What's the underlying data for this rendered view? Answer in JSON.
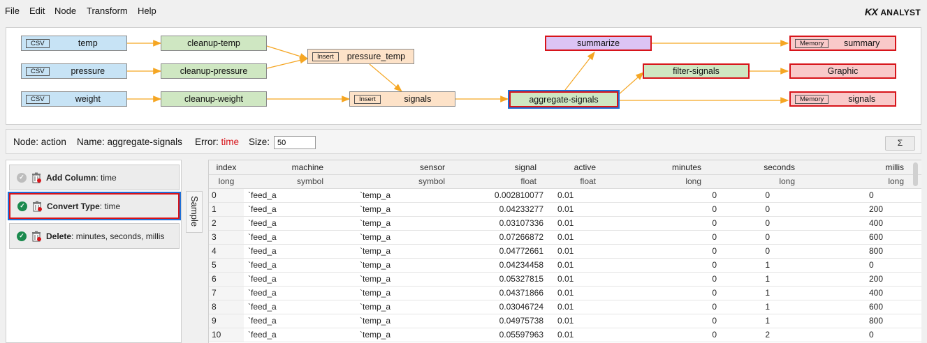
{
  "menu": {
    "items": [
      "File",
      "Edit",
      "Node",
      "Transform",
      "Help"
    ],
    "brand_logo": "KX",
    "brand_text": "ANALYST"
  },
  "workflow": {
    "nodes": {
      "csv_temp": {
        "tag": "CSV",
        "label": "temp"
      },
      "csv_pressure": {
        "tag": "CSV",
        "label": "pressure"
      },
      "csv_weight": {
        "tag": "CSV",
        "label": "weight"
      },
      "cleanup_temp": {
        "label": "cleanup-temp"
      },
      "cleanup_pressure": {
        "label": "cleanup-pressure"
      },
      "cleanup_weight": {
        "label": "cleanup-weight"
      },
      "pressure_temp": {
        "tag": "Insert",
        "label": "pressure_temp"
      },
      "signals_insert": {
        "tag": "Insert",
        "label": "signals"
      },
      "aggregate": {
        "label": "aggregate-signals"
      },
      "summarize": {
        "label": "summarize"
      },
      "filter": {
        "label": "filter-signals"
      },
      "summary_out": {
        "tag": "Memory",
        "label": "summary"
      },
      "graphic_out": {
        "label": "Graphic"
      },
      "signals_out": {
        "tag": "Memory",
        "label": "signals"
      }
    }
  },
  "info": {
    "node_label": "Node:",
    "node_value": "action",
    "name_label": "Name:",
    "name_value": "aggregate-signals",
    "error_label": "Error:",
    "error_value": "time",
    "size_label": "Size:",
    "size_value": "50",
    "sigma": "Σ"
  },
  "steps": [
    {
      "name": "Add Column",
      "detail": ": time",
      "status": "pending"
    },
    {
      "name": "Convert Type",
      "detail": ": time",
      "status": "ok"
    },
    {
      "name": "Delete",
      "detail": ": minutes, seconds, millis",
      "status": "ok"
    }
  ],
  "sample_tab": "Sample",
  "table": {
    "columns": [
      "index",
      "machine",
      "sensor",
      "signal",
      "active",
      "minutes",
      "seconds",
      "millis"
    ],
    "types": [
      "long",
      "symbol",
      "symbol",
      "float",
      "float",
      "long",
      "long",
      "long"
    ],
    "rows": [
      [
        "0",
        "`feed_a",
        "`temp_a",
        "0.002810077",
        "0.01",
        "0",
        "0",
        "0"
      ],
      [
        "1",
        "`feed_a",
        "`temp_a",
        "0.04233277",
        "0.01",
        "0",
        "0",
        "200"
      ],
      [
        "2",
        "`feed_a",
        "`temp_a",
        "0.03107336",
        "0.01",
        "0",
        "0",
        "400"
      ],
      [
        "3",
        "`feed_a",
        "`temp_a",
        "0.07266872",
        "0.01",
        "0",
        "0",
        "600"
      ],
      [
        "4",
        "`feed_a",
        "`temp_a",
        "0.04772661",
        "0.01",
        "0",
        "0",
        "800"
      ],
      [
        "5",
        "`feed_a",
        "`temp_a",
        "0.04234458",
        "0.01",
        "0",
        "1",
        "0"
      ],
      [
        "6",
        "`feed_a",
        "`temp_a",
        "0.05327815",
        "0.01",
        "0",
        "1",
        "200"
      ],
      [
        "7",
        "`feed_a",
        "`temp_a",
        "0.04371866",
        "0.01",
        "0",
        "1",
        "400"
      ],
      [
        "8",
        "`feed_a",
        "`temp_a",
        "0.03046724",
        "0.01",
        "0",
        "1",
        "600"
      ],
      [
        "9",
        "`feed_a",
        "`temp_a",
        "0.04975738",
        "0.01",
        "0",
        "1",
        "800"
      ],
      [
        "10",
        "`feed_a",
        "`temp_a",
        "0.05597963",
        "0.01",
        "0",
        "2",
        "0"
      ]
    ]
  },
  "colors": {
    "edge": "#f5a623",
    "error_border": "#d7141a",
    "selection": "#1f6fd6"
  }
}
